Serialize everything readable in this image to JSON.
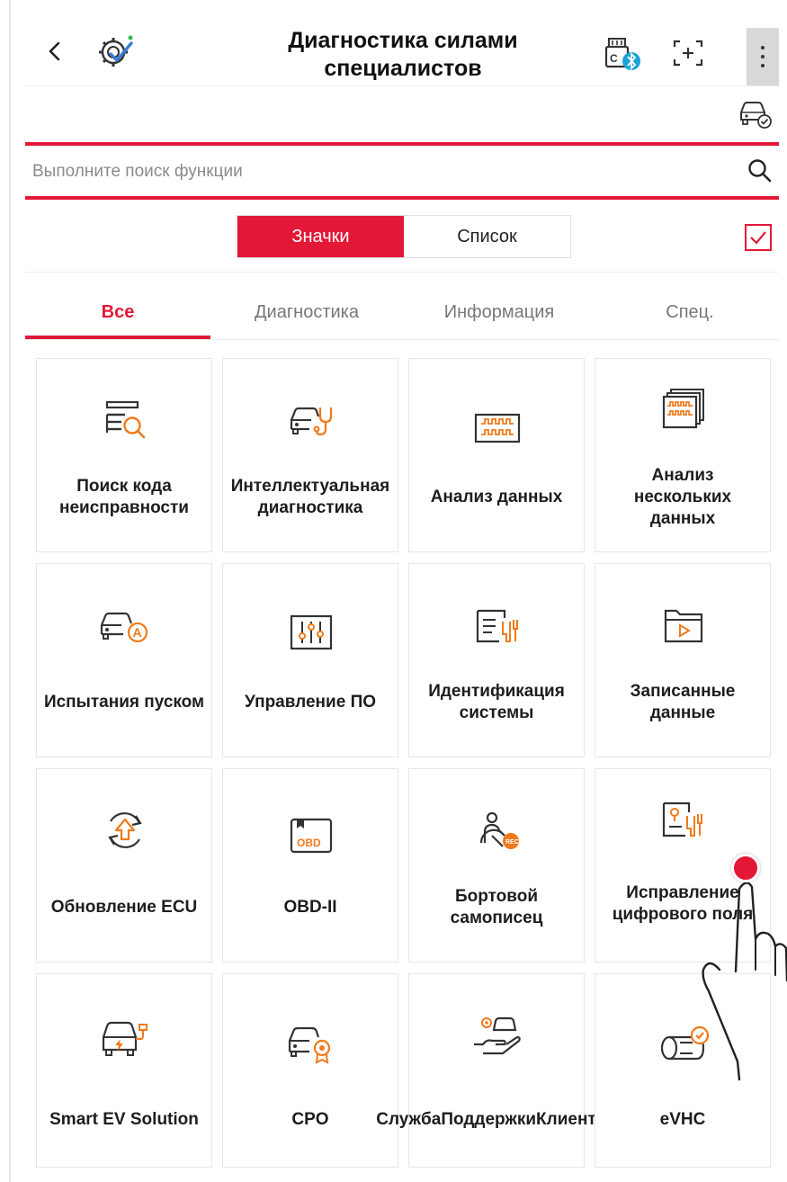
{
  "header": {
    "title": "Диагностика силами специалистов",
    "back_icon": "chevron-left-icon",
    "app_icon": "gear-check-icon",
    "vci_icon": "vci-bluetooth-icon",
    "scan_icon": "scan-plus-icon",
    "menu_icon": "more-vertical-icon"
  },
  "vehicle_status_icon": "car-check-icon",
  "search": {
    "placeholder": "Выполните поиск функции",
    "value": ""
  },
  "view_toggle": {
    "icons_label": "Значки",
    "list_label": "Список",
    "selected": "Значки"
  },
  "favorites_checkbox": {
    "checked": true
  },
  "tabs": [
    {
      "label": "Все",
      "active": true
    },
    {
      "label": "Диагностика",
      "active": false
    },
    {
      "label": "Информация",
      "active": false
    },
    {
      "label": "Спец.",
      "active": false
    }
  ],
  "functions": [
    {
      "label": "Поиск кода неисправности",
      "icon": "fault-code-search-icon"
    },
    {
      "label": "Интеллектуальная диагностика",
      "icon": "car-stethoscope-icon"
    },
    {
      "label": "Анализ данных",
      "icon": "data-wave-icon"
    },
    {
      "label": "Анализ нескольких данных",
      "icon": "multi-data-icon"
    },
    {
      "label": "Испытания пуском",
      "icon": "car-actuation-icon"
    },
    {
      "label": "Управление ПО",
      "icon": "sliders-icon"
    },
    {
      "label": "Идентификация системы",
      "icon": "system-id-icon"
    },
    {
      "label": "Записанные данные",
      "icon": "folder-play-icon"
    },
    {
      "label": "Обновление ECU",
      "icon": "ecu-update-icon"
    },
    {
      "label": "OBD-II",
      "icon": "obd-icon"
    },
    {
      "label": "Бортовой самописец",
      "icon": "driver-rec-icon"
    },
    {
      "label": "Исправление цифрового поля",
      "icon": "digital-field-icon"
    },
    {
      "label": "Smart EV Solution",
      "icon": "ev-car-icon"
    },
    {
      "label": "CPO",
      "icon": "car-badge-icon"
    },
    {
      "label": "СлужбаПоддержкиКлиентов",
      "icon": "customer-service-icon"
    },
    {
      "label": "eVHC",
      "icon": "evhc-icon"
    }
  ],
  "colors": {
    "accent": "#e31837",
    "icon_orange": "#f07a1a",
    "icon_dark": "#333333"
  }
}
